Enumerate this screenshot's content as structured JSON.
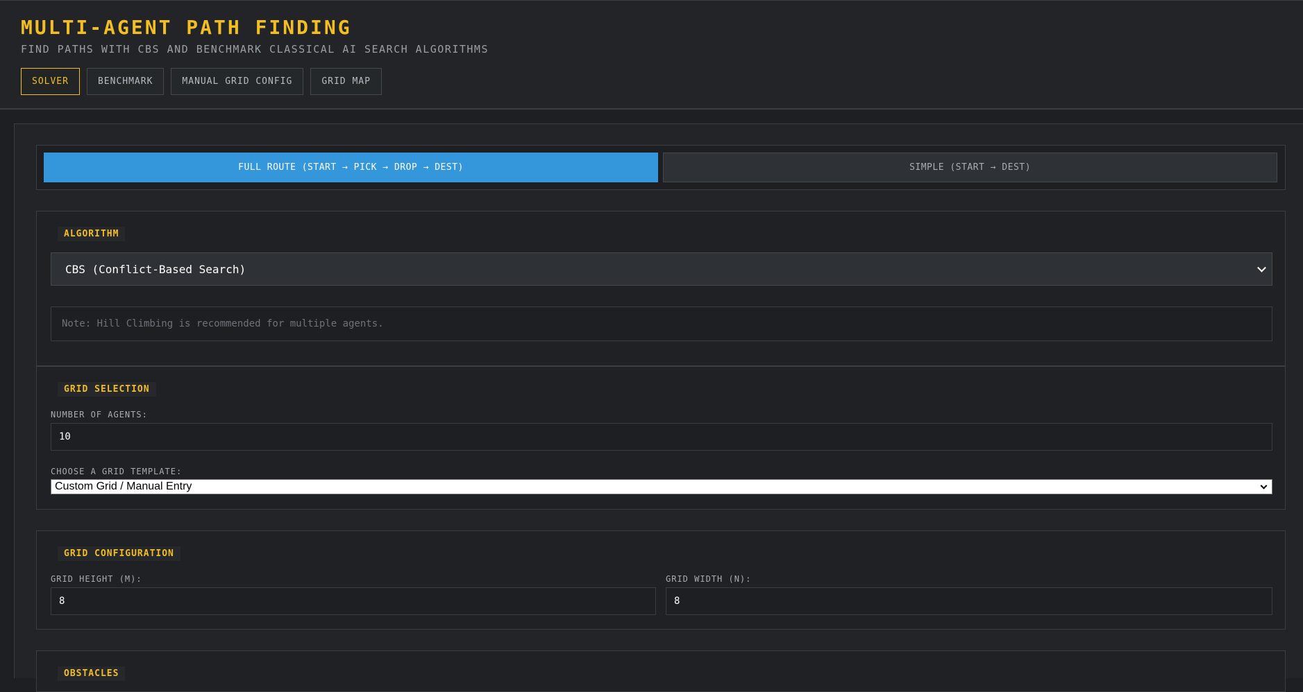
{
  "header": {
    "title": "MULTI-AGENT PATH FINDING",
    "subtitle": "FIND PATHS WITH CBS AND BENCHMARK CLASSICAL AI SEARCH ALGORITHMS",
    "tabs": [
      {
        "label": "SOLVER",
        "active": true
      },
      {
        "label": "BENCHMARK",
        "active": false
      },
      {
        "label": "MANUAL GRID CONFIG",
        "active": false
      },
      {
        "label": "GRID MAP",
        "active": false
      }
    ]
  },
  "mode": {
    "full_label": "FULL ROUTE (START → PICK → DROP → DEST)",
    "simple_label": "SIMPLE (START → DEST)",
    "selected": "full"
  },
  "algorithm": {
    "section_label": "ALGORITHM",
    "selected": "CBS (Conflict-Based Search)",
    "note": "Note: Hill Climbing is recommended for multiple agents."
  },
  "grid_selection": {
    "section_label": "GRID SELECTION",
    "agents_label": "NUMBER OF AGENTS:",
    "agents_value": "10",
    "template_label": "CHOOSE A GRID TEMPLATE:",
    "template_selected": "Custom Grid / Manual Entry"
  },
  "grid_configuration": {
    "section_label": "GRID CONFIGURATION",
    "height_label": "GRID HEIGHT (M):",
    "height_value": "8",
    "width_label": "GRID WIDTH (N):",
    "width_value": "8"
  },
  "obstacles": {
    "section_label": "OBSTACLES"
  },
  "colors": {
    "accent": "#f2be22",
    "primary": "#3597db",
    "background": "#1d1f22",
    "panel": "#222427"
  }
}
